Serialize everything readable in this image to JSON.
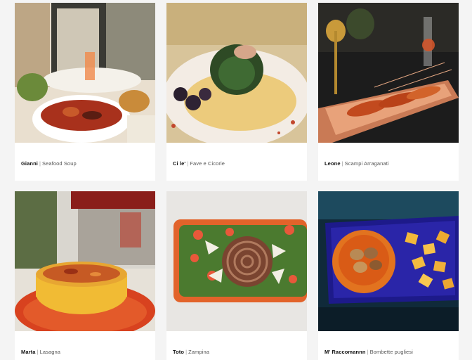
{
  "gallery": {
    "items": [
      {
        "restaurant": "Gianni",
        "separator": "|",
        "dish": "Seafood Soup"
      },
      {
        "restaurant": "Ci le'",
        "separator": "|",
        "dish": "Fave e Cicorie"
      },
      {
        "restaurant": "Leone",
        "separator": "|",
        "dish": "Scampi Arraganati"
      },
      {
        "restaurant": "Marta",
        "separator": "|",
        "dish": "Lasagna"
      },
      {
        "restaurant": "Toto",
        "separator": "|",
        "dish": "Zampina"
      },
      {
        "restaurant": "M' Raccomannn",
        "separator": "|",
        "dish": "Bombette pugliesi"
      }
    ]
  },
  "colors": {
    "page_background": "#f4f4f4",
    "card_background": "#ffffff"
  }
}
